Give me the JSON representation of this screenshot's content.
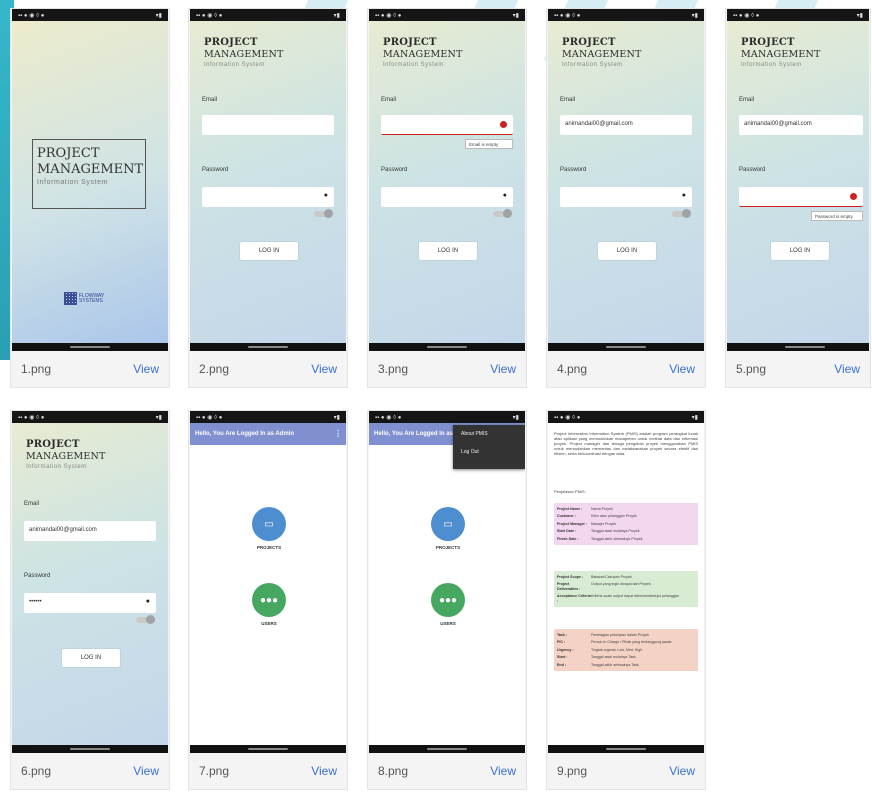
{
  "cards": [
    {
      "file": "1.png",
      "view": "View"
    },
    {
      "file": "2.png",
      "view": "View"
    },
    {
      "file": "3.png",
      "view": "View"
    },
    {
      "file": "4.png",
      "view": "View"
    },
    {
      "file": "5.png",
      "view": "View"
    },
    {
      "file": "6.png",
      "view": "View"
    },
    {
      "file": "7.png",
      "view": "View"
    },
    {
      "file": "8.png",
      "view": "View"
    },
    {
      "file": "9.png",
      "view": "View"
    }
  ],
  "app": {
    "title_line1": "PROJECT",
    "title_line2": "MANAGEMENT",
    "title_line3": "Information System",
    "email_label": "Email",
    "password_label": "Password",
    "login_button": "LOG IN",
    "email_value": "animandai00@gmail.com",
    "password_value": "••••••",
    "error_email": "Email is empty",
    "error_password": "Password is empty",
    "show_password_hint": "Show password",
    "company_logo": "FLOWWAY SYSTEMS",
    "greeting": "Hello, You Are Logged In as Admin",
    "projects_caption": "PROJECTS",
    "users_caption": "USERS",
    "menu_about": "About PMIS",
    "menu_logout": "Log Out"
  },
  "doc": {
    "intro": "Project Information Information System (PMIS) adalah program perangkat lunak atau aplikasi yang memudahkan manajemen untuk melihat data dan informasi proyek. Project manager dan tenaga pengelola proyek menggunakan PMIS untuk memudahkan memantau dan melaksanakan proyek secara efektif dan efisien, serta terkoordinasi dengan data.",
    "subtitle": "Penjelasan PMIS:",
    "panel1": [
      {
        "k": "Project Name :",
        "v": "Nama Proyek"
      },
      {
        "k": "Customer :",
        "v": "Klien atau pelanggan Proyek"
      },
      {
        "k": "Project Manager :",
        "v": "Manajer Proyek"
      },
      {
        "k": "Start Date :",
        "v": "Tanggal awal mulainya Proyek"
      },
      {
        "k": "Finish Date :",
        "v": "Tanggal akhir selesainya Proyek"
      }
    ],
    "panel2": [
      {
        "k": "Project Scope :",
        "v": "Batasan/Cakupan Proyek"
      },
      {
        "k": "Project Deliverables :",
        "v": "Output yang ingin dicapai dari Proyek"
      },
      {
        "k": "Acceptance Criteria :",
        "v": "Kriteria suatu output dapat diterima/disetujui pelanggan"
      }
    ],
    "panel3": [
      {
        "k": "Task :",
        "v": "Pembagian pekerjaan dalam Proyek"
      },
      {
        "k": "PIC :",
        "v": "Person In Charge / Pihak yang bertanggung jawab"
      },
      {
        "k": "Urgency :",
        "v": "Tingkat urgensi: Low, Med, High"
      },
      {
        "k": "Start :",
        "v": "Tanggal awal mulainya Task"
      },
      {
        "k": "End :",
        "v": "Tanggal akhir selesainya Task"
      }
    ]
  },
  "colors": {
    "accent": "#3b6fd8",
    "appbar": "#7f8fcf",
    "teal_deco": "#36b7c9",
    "panel_pink": "#f3d7ef",
    "panel_green": "#d8ecd4",
    "panel_salmon": "#f4d2c6",
    "error": "#cc2222"
  }
}
